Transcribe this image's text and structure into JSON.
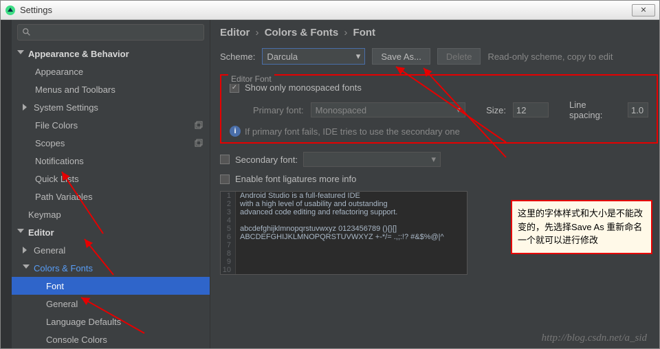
{
  "window": {
    "title": "Settings"
  },
  "breadcrumb": {
    "a": "Editor",
    "b": "Colors & Fonts",
    "c": "Font"
  },
  "scheme": {
    "label": "Scheme:",
    "value": "Darcula",
    "save_as": "Save As...",
    "delete": "Delete",
    "readonly_msg": "Read-only scheme, copy to edit"
  },
  "editor_font": {
    "legend": "Editor Font",
    "show_mono": "Show only monospaced fonts",
    "primary_label": "Primary font:",
    "primary_value": "Monospaced",
    "size_label": "Size:",
    "size_value": "12",
    "spacing_label": "Line spacing:",
    "spacing_value": "1.0",
    "info": "If primary font fails, IDE tries to use the secondary one",
    "secondary_label": "Secondary font:",
    "ligatures": "Enable font ligatures more info"
  },
  "tree": {
    "appearance_behavior": "Appearance & Behavior",
    "appearance": "Appearance",
    "menus_toolbars": "Menus and Toolbars",
    "system_settings": "System Settings",
    "file_colors": "File Colors",
    "scopes": "Scopes",
    "notifications": "Notifications",
    "quick_lists": "Quick Lists",
    "path_variables": "Path Variables",
    "keymap": "Keymap",
    "editor": "Editor",
    "general": "General",
    "colors_fonts": "Colors & Fonts",
    "font": "Font",
    "general2": "General",
    "lang_defaults": "Language Defaults",
    "console_colors": "Console Colors"
  },
  "preview": [
    "Android Studio is a full-featured IDE",
    "with a high level of usability and outstanding",
    "advanced code editing and refactoring support.",
    "",
    "abcdefghijklmnopqrstuvwxyz 0123456789 (){}[]",
    "ABCDEFGHIJKLMNOPQRSTUVWXYZ +-*/= .,;:!? #&$%@|^",
    "",
    "",
    "",
    ""
  ],
  "annotation": "这里的字体样式和大小是不能改变的，先选择Save As 重新命名一个就可以进行修改",
  "watermark": "http://blog.csdn.net/a_sid"
}
